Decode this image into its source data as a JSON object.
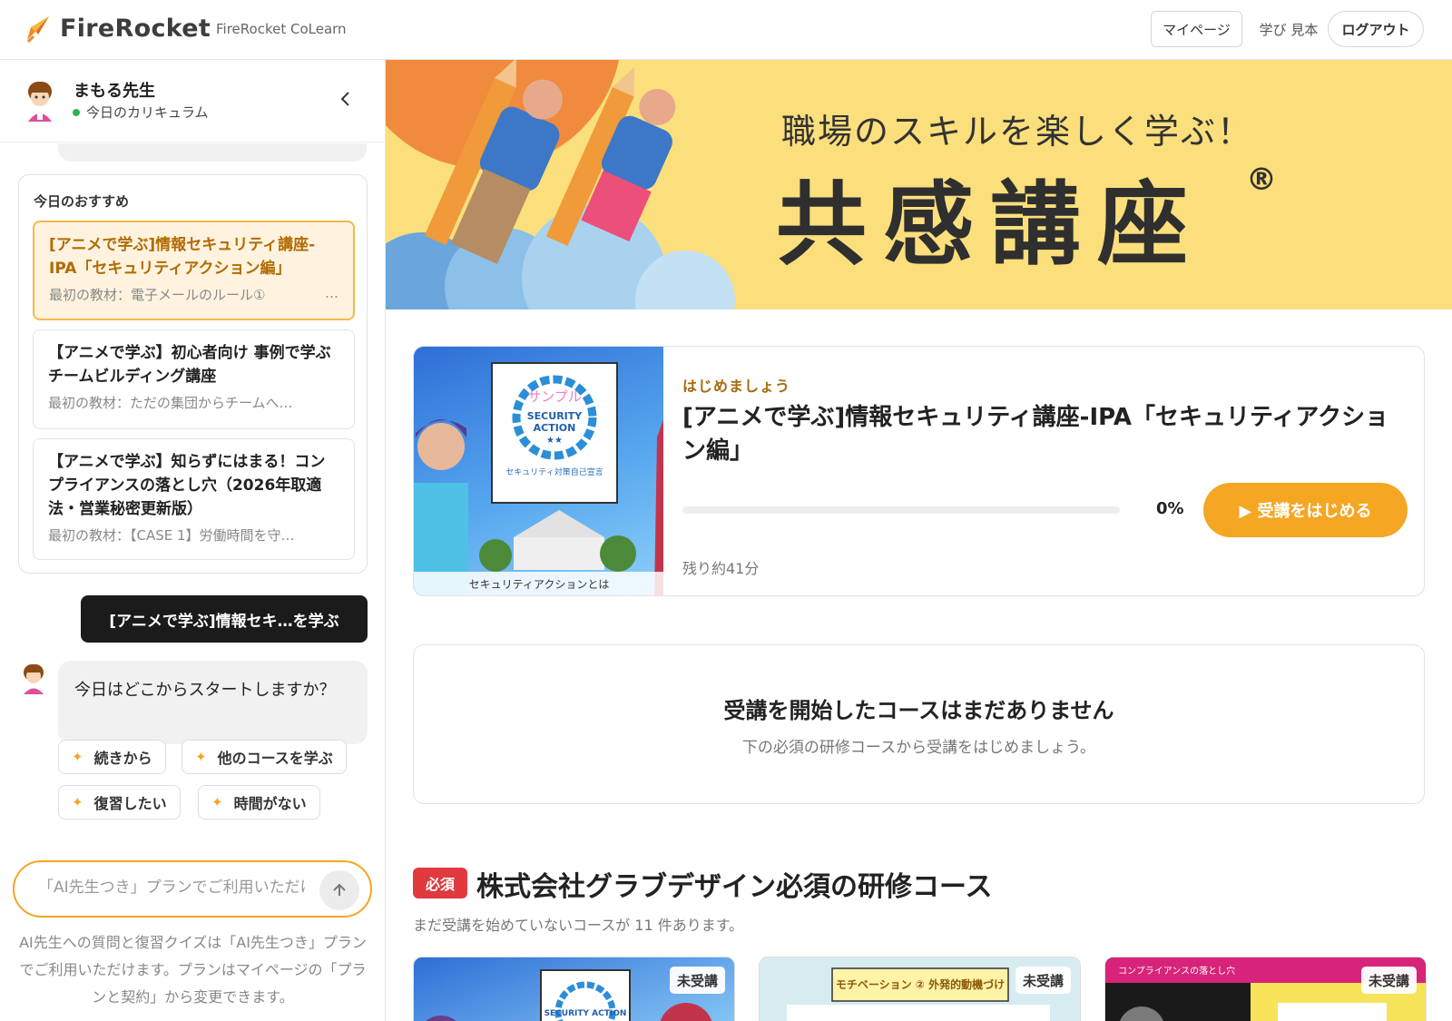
{
  "header": {
    "logo_text": "FireRocket",
    "sub_brand": "FireRocket CoLearn",
    "nav": {
      "mypage": "マイページ",
      "manabi": "学び 見本",
      "logout": "ログアウト"
    }
  },
  "sidebar": {
    "teacher_name": "まもる先生",
    "status": "今日のカリキュラム",
    "recommend": {
      "title": "今日のおすすめ",
      "items": [
        {
          "title": "[アニメで学ぶ]情報セキュリティ講座-IPA「セキュリティアクション編」",
          "sub": "最初の教材：電子メールのルール①",
          "more": "…"
        },
        {
          "title": "【アニメで学ぶ】初心者向け 事例で学ぶチームビルディング講座",
          "sub": "最初の教材：ただの集団からチームへ…"
        },
        {
          "title": "【アニメで学ぶ】知らずにはまる！コンプライアンスの落とし穴（2026年取適法・営業秘密更新版）",
          "sub": "最初の教材：【CASE 1】労働時間を守…"
        }
      ]
    },
    "user_message": "[アニメで学ぶ]情報セキ…を学ぶ",
    "bot_message": "今日はどこからスタートしますか？",
    "chips": [
      "続きから",
      "他のコースを学ぶ",
      "復習したい",
      "時間がない"
    ],
    "chat_placeholder": "「AI先生つき」プランでご利用いただけます",
    "chat_note": "AI先生への質問と復習クイズは「AI先生つき」プランでご利用いただけます。プランはマイページの「プランと契約」から変更できます。"
  },
  "banner": {
    "subtitle": "職場のスキルを楽しく学ぶ！",
    "title": "共感講座",
    "reg_mark": "®"
  },
  "current_course": {
    "label": "はじめましょう",
    "title": "[アニメで学ぶ]情報セキュリティ講座-IPA「セキュリティアクション編」",
    "progress": 0,
    "progress_text": "0%",
    "start_button": "▶ 受講をはじめる",
    "remaining": "残り約41分",
    "thumb": {
      "sample_text": "サンプル",
      "badge_line1": "SECURITY",
      "badge_line2": "ACTION",
      "stars": "★★",
      "declaration": "セキュリティ対策自己宣言",
      "caption": "セキュリティアクションとは"
    }
  },
  "empty_state": {
    "title": "受講を開始したコースはまだありません",
    "subtitle": "下の必須の研修コースから受講をはじめましょう。"
  },
  "required": {
    "badge": "必須",
    "title": "株式会社グラブデザイン必須の研修コース",
    "subtitle": "まだ受講を始めていないコースが 11 件あります。",
    "cards": [
      {
        "badge": "未受講",
        "thumb_text": "SECURITY ACTION"
      },
      {
        "badge": "未受講",
        "thumb_text": "モチベーション ② 外発的動機づけ"
      },
      {
        "badge": "未受講",
        "thumb_text": "コンプライアンスの落とし穴"
      }
    ]
  },
  "colors": {
    "accent": "#f5a623",
    "banner_bg": "#fbdf7c",
    "required_red": "#e0393e"
  }
}
